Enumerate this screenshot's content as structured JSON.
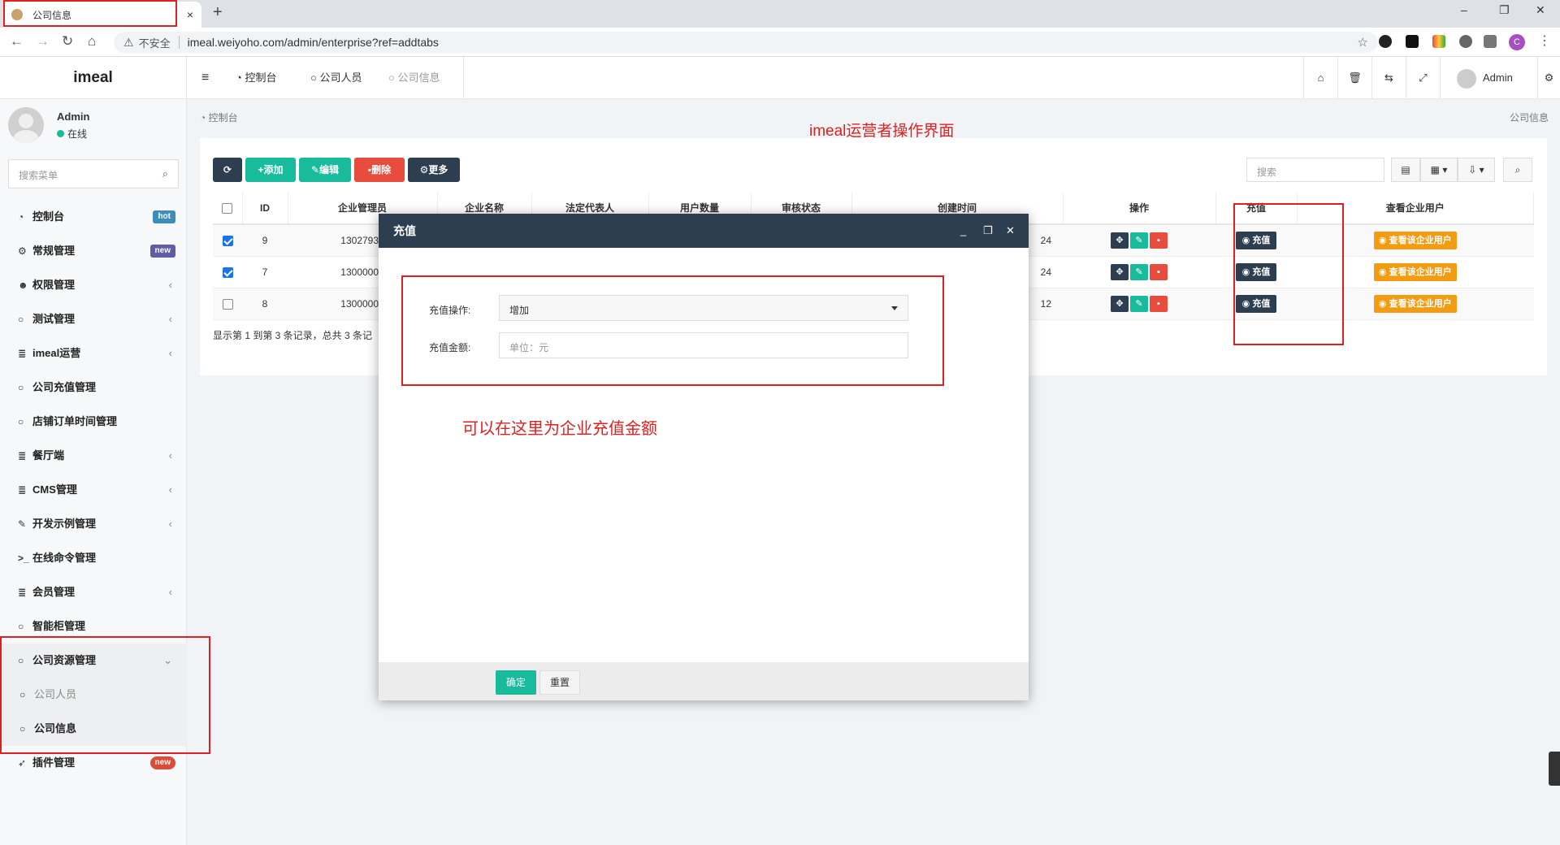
{
  "browser": {
    "tab_title": "公司信息",
    "tab_close": "×",
    "new_tab": "+",
    "insecure_label": "不安全",
    "url": "imeal.weiyoho.com/admin/enterprise?ref=addtabs",
    "win_min": "–",
    "win_max": "❐",
    "win_close": "✕",
    "profile_initial": "C"
  },
  "sidebar": {
    "logo": "imeal",
    "user_name": "Admin",
    "user_status": "在线",
    "search_placeholder": "搜索菜单",
    "items": [
      {
        "label": "控制台",
        "icon": "dashboard-icon",
        "badge": "hot",
        "badge_color": "#3c8dbc"
      },
      {
        "label": "常规管理",
        "icon": "cogs-icon",
        "badge": "new",
        "badge_color": "#605ca8"
      },
      {
        "label": "权限管理",
        "icon": "group-icon",
        "arrow": "‹"
      },
      {
        "label": "测试管理",
        "icon": "circle-icon",
        "arrow": "‹"
      },
      {
        "label": "imeal运营",
        "icon": "list-icon",
        "arrow": "‹"
      },
      {
        "label": "公司充值管理",
        "icon": "circle-icon"
      },
      {
        "label": "店铺订单时间管理",
        "icon": "circle-icon"
      },
      {
        "label": "餐厅端",
        "icon": "list-icon",
        "arrow": "‹"
      },
      {
        "label": "CMS管理",
        "icon": "list-icon",
        "arrow": "‹"
      },
      {
        "label": "开发示例管理",
        "icon": "magic-icon",
        "arrow": "‹"
      },
      {
        "label": "在线命令管理",
        "icon": "terminal-icon"
      },
      {
        "label": "会员管理",
        "icon": "list-icon",
        "arrow": "‹"
      },
      {
        "label": "智能柜管理",
        "icon": "circle-icon"
      },
      {
        "label": "公司资源管理",
        "icon": "circle-icon",
        "arrow": "⌄"
      },
      {
        "label": "公司人员",
        "icon": "circle-icon"
      },
      {
        "label": "公司信息",
        "icon": "circle-icon"
      },
      {
        "label": "插件管理",
        "icon": "rocket-icon",
        "badge": "new",
        "badge_color": "#dd4b39"
      }
    ]
  },
  "topbar": {
    "menu_toggle": "≡",
    "tabs": [
      "控制台",
      "公司人员",
      "公司信息"
    ],
    "admin": "Admin"
  },
  "content": {
    "breadcrumb": "控制台",
    "breadcrumb_right": "公司信息",
    "annotation_title": "imeal运营者操作界面",
    "toolbar": {
      "refresh": "⟳",
      "add": "添加",
      "edit": "编辑",
      "delete": "删除",
      "more": "更多",
      "search_placeholder": "搜索"
    },
    "table": {
      "headers": [
        "ID",
        "企业管理员",
        "企业名称",
        "法定代表人",
        "用户数量",
        "审核状态",
        "创建时间",
        "操作",
        "充值",
        "查看企业用户"
      ],
      "rows": [
        {
          "checked": true,
          "id": "9",
          "admin": "13027939",
          "created": "24",
          "recharge": "充值",
          "view": "查看该企业用户"
        },
        {
          "checked": true,
          "id": "7",
          "admin": "13000000",
          "created": "24",
          "recharge": "充值",
          "view": "查看该企业用户"
        },
        {
          "checked": false,
          "id": "8",
          "admin": "13000000",
          "created": "12",
          "recharge": "充值",
          "view": "查看该企业用户"
        }
      ]
    },
    "footer_info": "显示第 1 到第 3 条记录，总共 3 条记"
  },
  "modal": {
    "title": "充值",
    "op_label": "充值操作:",
    "op_value": "增加",
    "amount_label": "充值金额:",
    "amount_placeholder": "单位：元",
    "annotation": "可以在这里为企业充值金额",
    "confirm": "确定",
    "reset": "重置"
  },
  "colors": {
    "green": "#18bc9c",
    "red": "#e74c3c",
    "dark": "#2c3e50",
    "orange": "#f39c12",
    "annotation_red": "#e02020"
  }
}
